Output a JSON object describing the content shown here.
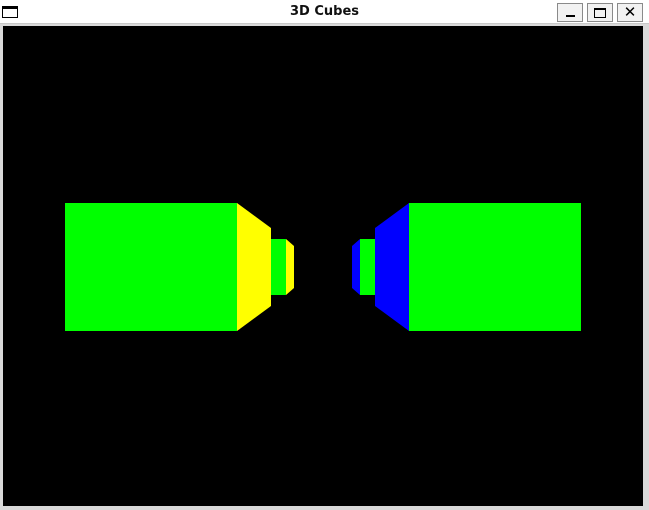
{
  "window": {
    "title": "3D Cubes",
    "controls": {
      "minimize_icon": "minimize-icon",
      "maximize_icon": "maximize-icon",
      "close_glyph": "✕"
    }
  },
  "scene": {
    "background": "#000000",
    "colors": {
      "green": "#00ff00",
      "yellow": "#ffff00",
      "blue": "#0000ff"
    }
  }
}
